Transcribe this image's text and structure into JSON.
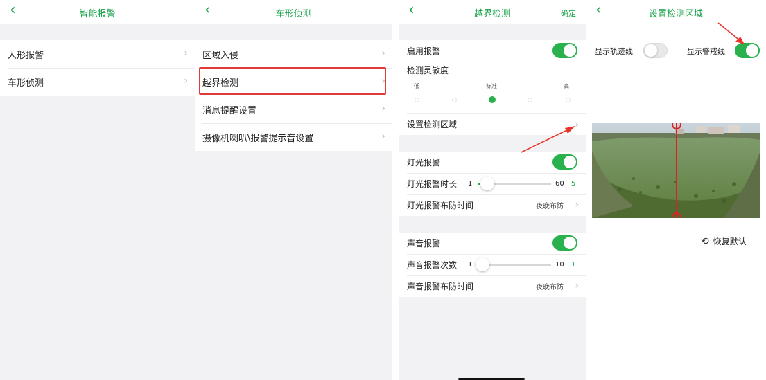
{
  "panel1": {
    "title": "智能报警",
    "items": [
      {
        "label": "人形报警"
      },
      {
        "label": "车形侦测"
      }
    ]
  },
  "panel2": {
    "title": "车形侦测",
    "items": [
      {
        "label": "区域入侵"
      },
      {
        "label": "越界检测"
      },
      {
        "label": "消息提醒设置"
      },
      {
        "label": "摄像机喇叭\\报警提示音设置"
      }
    ]
  },
  "panel3": {
    "title": "越界检测",
    "action": "确定",
    "enable_alarm": {
      "label": "启用报警",
      "on": true
    },
    "sensitivity": {
      "label": "检测灵敏度",
      "low": "低",
      "standard": "标准",
      "high": "高",
      "steps": 5,
      "selected_index": 2
    },
    "set_region": {
      "label": "设置检测区域"
    },
    "light": {
      "alarm_label": "灯光报警",
      "alarm_on": true,
      "duration_label": "灯光报警时长",
      "duration_min": "1",
      "duration_max": "60",
      "duration_value": "5",
      "duration_fraction": 0.07,
      "schedule_label": "灯光报警布防时间",
      "schedule_value": "夜晚布防"
    },
    "sound": {
      "alarm_label": "声音报警",
      "alarm_on": true,
      "count_label": "声音报警次数",
      "count_min": "1",
      "count_max": "10",
      "count_value": "1",
      "count_fraction": 0.0,
      "schedule_label": "声音报警布防时间",
      "schedule_value": "夜晚布防"
    }
  },
  "panel4": {
    "title": "设置检测区域",
    "show_track": {
      "label": "显示轨迹线",
      "on": false
    },
    "show_line": {
      "label": "显示警戒线",
      "on": true
    },
    "restore_label": "恢复默认"
  },
  "colors": {
    "accent_green": "#1aa34a",
    "toggle_green": "#28b14c",
    "highlight_red": "#e03a3a",
    "arrow_red": "#e8352a",
    "background_gray": "#f2f2f4"
  },
  "icons": [
    "back-chevron-icon",
    "right-chevron-icon",
    "restore-icon",
    "annotation-arrow-icon"
  ]
}
